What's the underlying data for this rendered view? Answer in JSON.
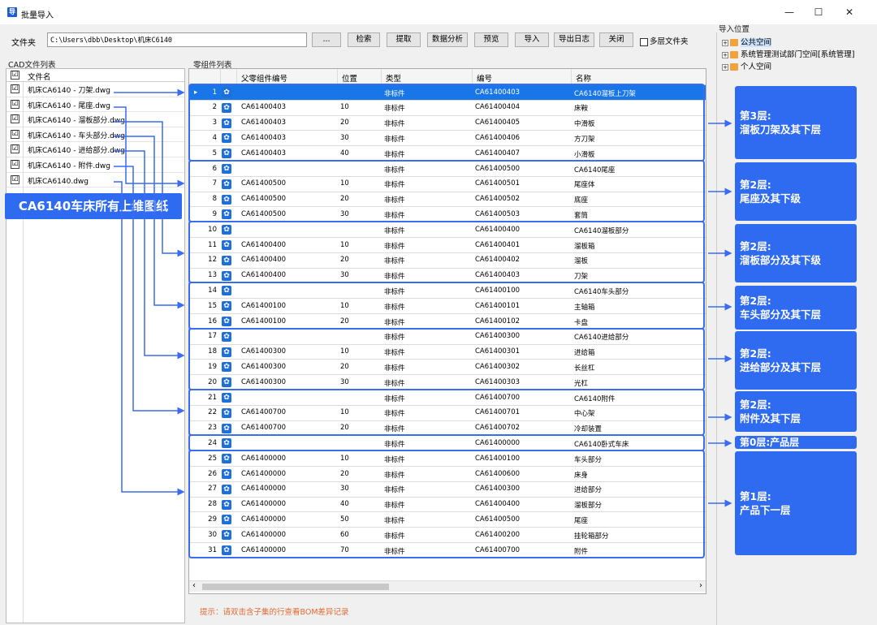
{
  "window": {
    "title": "批量导入",
    "app_icon": "导",
    "minimize": "—",
    "maximize": "☐",
    "close": "✕"
  },
  "toolbar": {
    "folder_label": "文件夹",
    "path": "C:\\Users\\dbb\\Desktop\\机床C6140",
    "buttons": [
      "...",
      "检索",
      "提取",
      "数据分析",
      "预览",
      "导入",
      "导出日志",
      "关闭"
    ],
    "multi_folder": "多层文件夹"
  },
  "cad_list": {
    "title": "CAD文件列表",
    "column": "文件名",
    "files": [
      "机床CA6140 - 刀架.dwg",
      "机床CA6140 - 尾座.dwg",
      "机床CA6140 - 溜板部分.dwg",
      "机床CA6140 - 车头部分.dwg",
      "机床CA6140 - 进给部分.dwg",
      "机床CA6140 - 附件.dwg",
      "机床CA6140.dwg"
    ],
    "check": "☑",
    "banner": "CA6140车床所有上维图纸"
  },
  "parts": {
    "title": "零组件列表",
    "columns": [
      "父零组件编号",
      "位置",
      "类型",
      "编号",
      "名称"
    ],
    "rows": [
      {
        "n": "1",
        "parent": "",
        "pos": "",
        "type": "非标件",
        "code": "CA61400403",
        "name": "CA6140溜板上刀架"
      },
      {
        "n": "2",
        "parent": "CA61400403",
        "pos": "10",
        "type": "非标件",
        "code": "CA61400404",
        "name": "床鞍"
      },
      {
        "n": "3",
        "parent": "CA61400403",
        "pos": "20",
        "type": "非标件",
        "code": "CA61400405",
        "name": "中滑板"
      },
      {
        "n": "4",
        "parent": "CA61400403",
        "pos": "30",
        "type": "非标件",
        "code": "CA61400406",
        "name": "方刀架"
      },
      {
        "n": "5",
        "parent": "CA61400403",
        "pos": "40",
        "type": "非标件",
        "code": "CA61400407",
        "name": "小滑板"
      },
      {
        "n": "6",
        "parent": "",
        "pos": "",
        "type": "非标件",
        "code": "CA61400500",
        "name": "CA6140尾座"
      },
      {
        "n": "7",
        "parent": "CA61400500",
        "pos": "10",
        "type": "非标件",
        "code": "CA61400501",
        "name": "尾座体"
      },
      {
        "n": "8",
        "parent": "CA61400500",
        "pos": "20",
        "type": "非标件",
        "code": "CA61400502",
        "name": "底座"
      },
      {
        "n": "9",
        "parent": "CA61400500",
        "pos": "30",
        "type": "非标件",
        "code": "CA61400503",
        "name": "套筒"
      },
      {
        "n": "10",
        "parent": "",
        "pos": "",
        "type": "非标件",
        "code": "CA61400400",
        "name": "CA6140溜板部分"
      },
      {
        "n": "11",
        "parent": "CA61400400",
        "pos": "10",
        "type": "非标件",
        "code": "CA61400401",
        "name": "溜板箱"
      },
      {
        "n": "12",
        "parent": "CA61400400",
        "pos": "20",
        "type": "非标件",
        "code": "CA61400402",
        "name": "溜板"
      },
      {
        "n": "13",
        "parent": "CA61400400",
        "pos": "30",
        "type": "非标件",
        "code": "CA61400403",
        "name": "刀架"
      },
      {
        "n": "14",
        "parent": "",
        "pos": "",
        "type": "非标件",
        "code": "CA61400100",
        "name": "CA6140车头部分"
      },
      {
        "n": "15",
        "parent": "CA61400100",
        "pos": "10",
        "type": "非标件",
        "code": "CA61400101",
        "name": "主轴箱"
      },
      {
        "n": "16",
        "parent": "CA61400100",
        "pos": "20",
        "type": "非标件",
        "code": "CA61400102",
        "name": "卡盘"
      },
      {
        "n": "17",
        "parent": "",
        "pos": "",
        "type": "非标件",
        "code": "CA61400300",
        "name": "CA6140进给部分"
      },
      {
        "n": "18",
        "parent": "CA61400300",
        "pos": "10",
        "type": "非标件",
        "code": "CA61400301",
        "name": "进给箱"
      },
      {
        "n": "19",
        "parent": "CA61400300",
        "pos": "20",
        "type": "非标件",
        "code": "CA61400302",
        "name": "长丝杠"
      },
      {
        "n": "20",
        "parent": "CA61400300",
        "pos": "30",
        "type": "非标件",
        "code": "CA61400303",
        "name": "光杠"
      },
      {
        "n": "21",
        "parent": "",
        "pos": "",
        "type": "非标件",
        "code": "CA61400700",
        "name": "CA6140附件"
      },
      {
        "n": "22",
        "parent": "CA61400700",
        "pos": "10",
        "type": "非标件",
        "code": "CA61400701",
        "name": "中心架"
      },
      {
        "n": "23",
        "parent": "CA61400700",
        "pos": "20",
        "type": "非标件",
        "code": "CA61400702",
        "name": "冷却装置"
      },
      {
        "n": "24",
        "parent": "",
        "pos": "",
        "type": "非标件",
        "code": "CA61400000",
        "name": "CA6140卧式车床"
      },
      {
        "n": "25",
        "parent": "CA61400000",
        "pos": "10",
        "type": "非标件",
        "code": "CA61400100",
        "name": "车头部分"
      },
      {
        "n": "26",
        "parent": "CA61400000",
        "pos": "20",
        "type": "非标件",
        "code": "CA61400600",
        "name": "床身"
      },
      {
        "n": "27",
        "parent": "CA61400000",
        "pos": "30",
        "type": "非标件",
        "code": "CA61400300",
        "name": "进给部分"
      },
      {
        "n": "28",
        "parent": "CA61400000",
        "pos": "40",
        "type": "非标件",
        "code": "CA61400400",
        "name": "溜板部分"
      },
      {
        "n": "29",
        "parent": "CA61400000",
        "pos": "50",
        "type": "非标件",
        "code": "CA61400500",
        "name": "尾座"
      },
      {
        "n": "30",
        "parent": "CA61400000",
        "pos": "60",
        "type": "非标件",
        "code": "CA61400200",
        "name": "挂轮箱部分"
      },
      {
        "n": "31",
        "parent": "CA61400000",
        "pos": "70",
        "type": "非标件",
        "code": "CA61400700",
        "name": "附件"
      }
    ],
    "row_marker": "▸",
    "gear_glyph": "✿",
    "hint": "提示：请双击含子集的行查看BOM差异记录",
    "scroll_left": "‹",
    "scroll_right": "›"
  },
  "import_location": {
    "title": "导入位置",
    "items": [
      "公共空间",
      "系统管理测试部门空间[系统管理]",
      "个人空间"
    ]
  },
  "layers": [
    {
      "title": "第3层:",
      "desc": "溜板刀架及其下层"
    },
    {
      "title": "第2层:",
      "desc": "尾座及其下级"
    },
    {
      "title": "第2层:",
      "desc": "溜板部分及其下级"
    },
    {
      "title": "第2层:",
      "desc": "车头部分及其下层"
    },
    {
      "title": "第2层:",
      "desc": "进给部分及其下层"
    },
    {
      "title": "第2层:",
      "desc": "附件及其下层"
    },
    {
      "title": "第0层:产品层",
      "desc": ""
    },
    {
      "title": "第1层:",
      "desc": "产品下一层"
    }
  ],
  "colors": {
    "accent": "#2f6bf0",
    "selected_row": "#1976e8",
    "hint": "#e06a30"
  }
}
